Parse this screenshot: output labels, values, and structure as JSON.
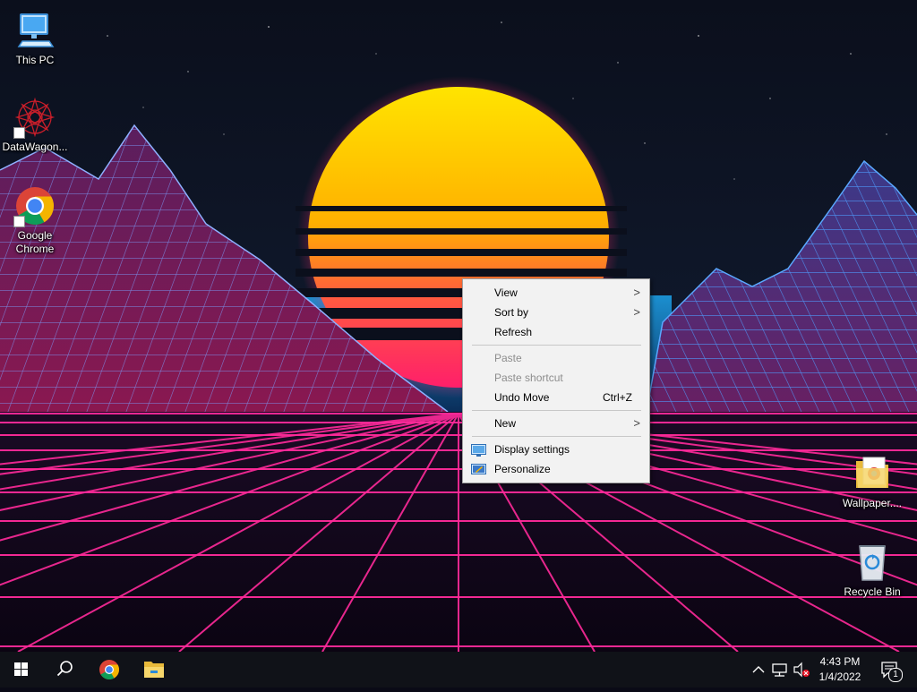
{
  "desktop": {
    "icons": [
      {
        "label": "This PC",
        "icon": "computer-icon"
      },
      {
        "label": "DataWagon...",
        "icon": "datawagon-icon"
      },
      {
        "label": "Google Chrome",
        "icon": "chrome-icon"
      },
      {
        "label": "Wallpaper....",
        "icon": "folder-icon"
      },
      {
        "label": "Recycle Bin",
        "icon": "recycle-bin-icon"
      }
    ]
  },
  "context_menu": {
    "view": "View",
    "sort_by": "Sort by",
    "refresh": "Refresh",
    "paste": "Paste",
    "paste_shortcut": "Paste shortcut",
    "undo_move": "Undo Move",
    "undo_shortcut": "Ctrl+Z",
    "new": "New",
    "display_settings": "Display settings",
    "personalize": "Personalize",
    "submenu_arrow": ">"
  },
  "taskbar": {
    "time": "4:43 PM",
    "date": "1/4/2022",
    "notification_count": "1",
    "icons": [
      "windows-start-icon",
      "search-icon",
      "chrome-icon",
      "file-explorer-icon"
    ]
  },
  "colors": {
    "sun_top": "#ffee00",
    "sun_bottom": "#ff2255",
    "grid": "#ff2a9a",
    "mountain_lines": "#3a7dff",
    "taskbar": "#101218"
  }
}
